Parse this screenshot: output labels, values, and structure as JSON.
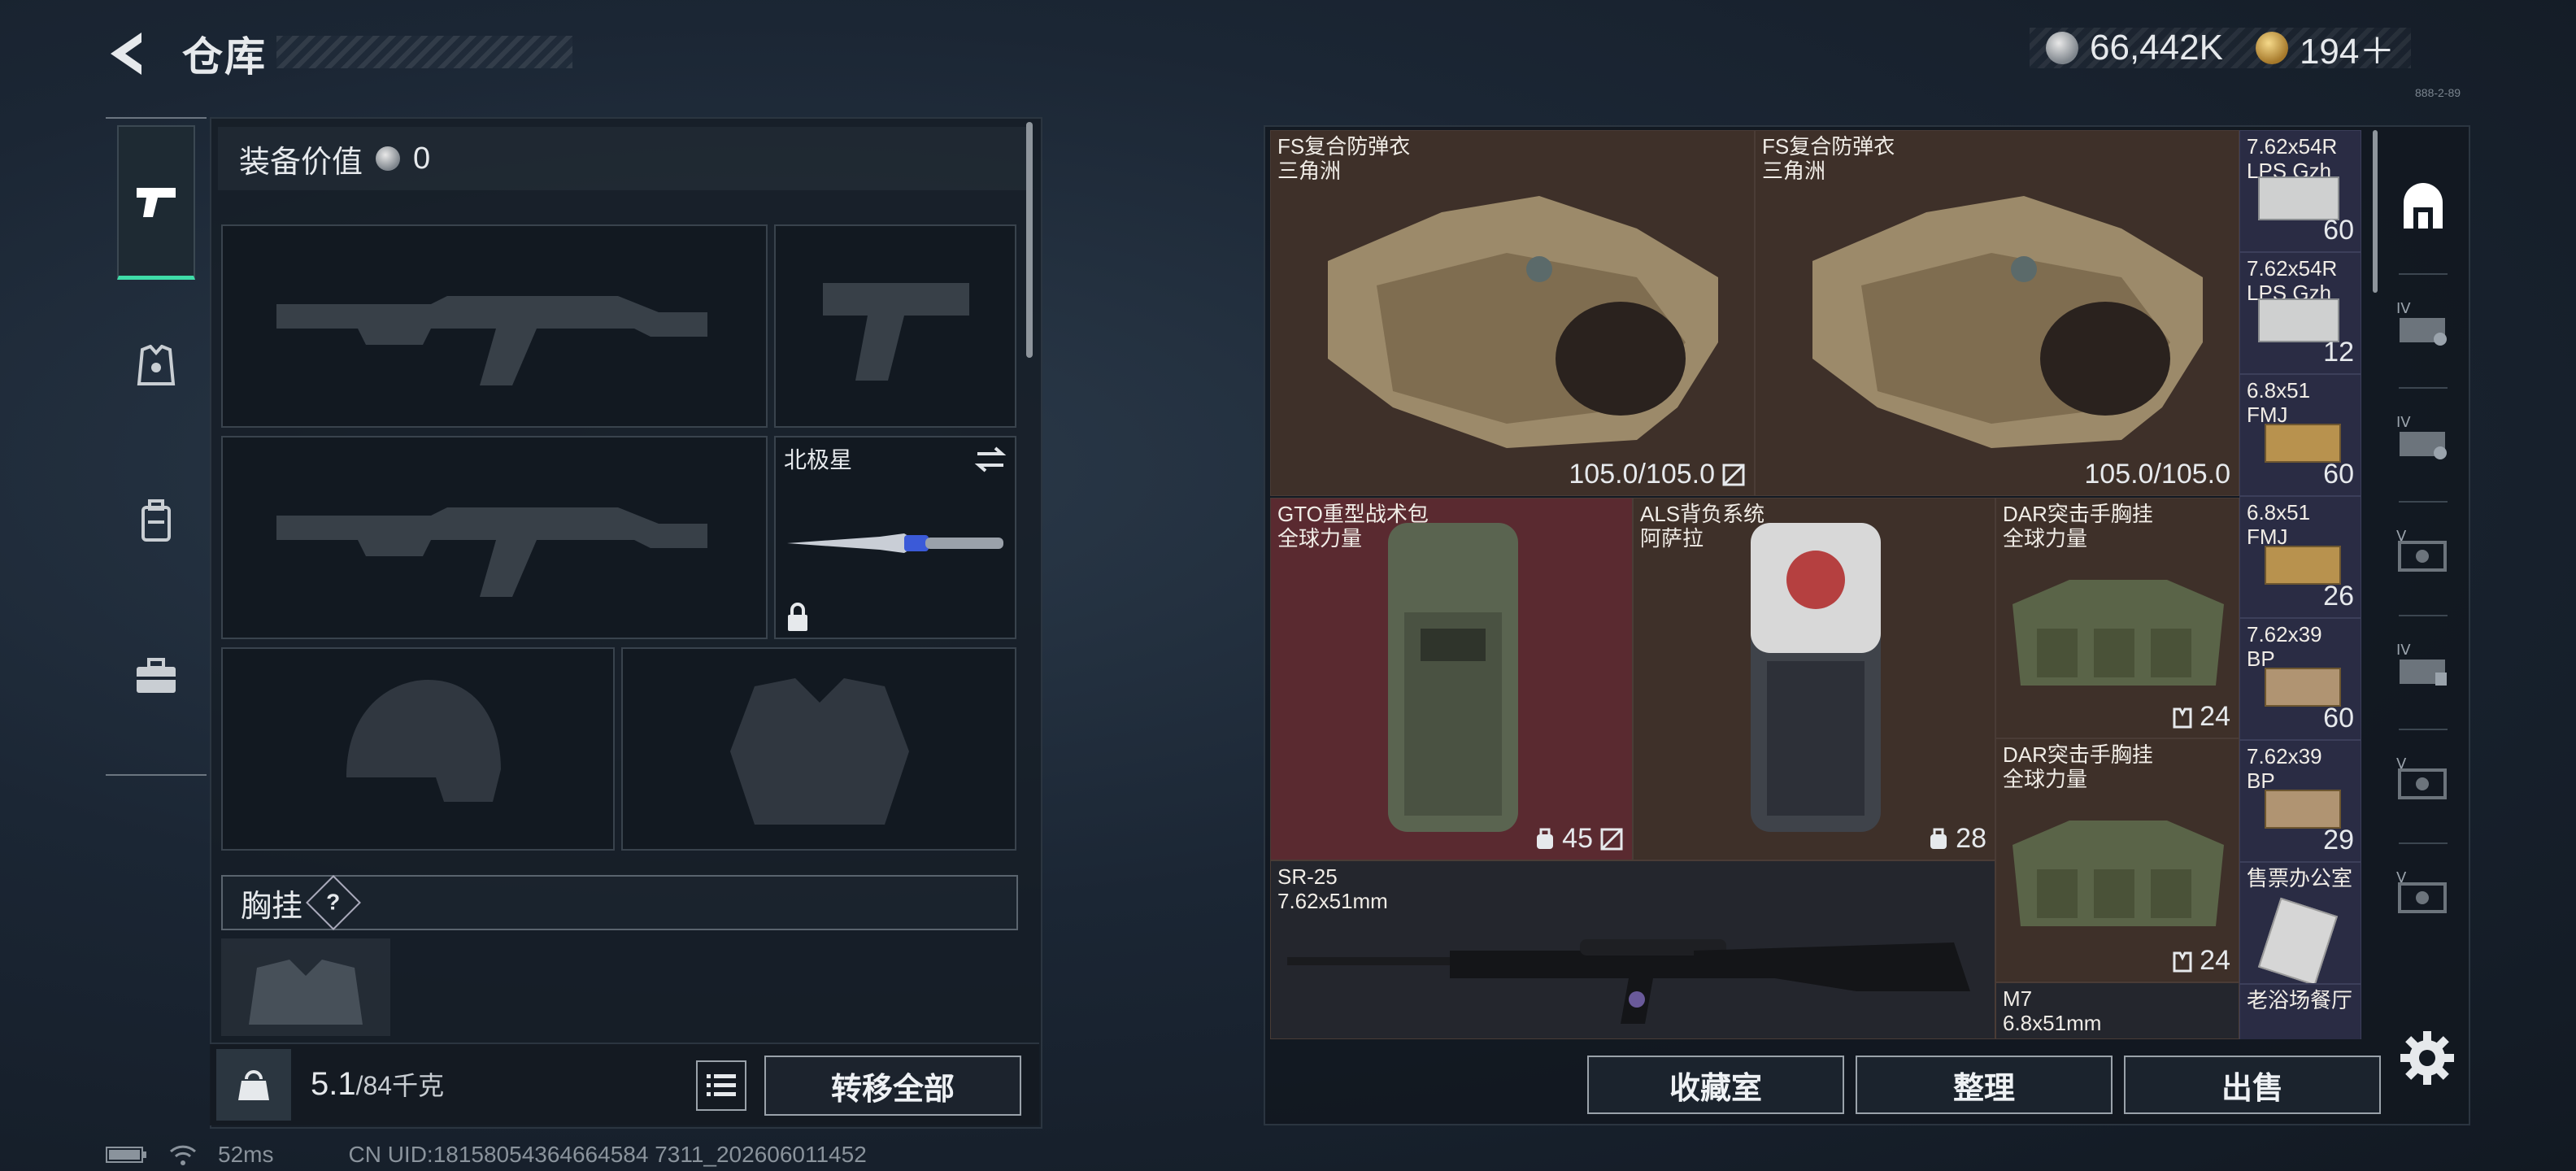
{
  "header": {
    "title": "仓库"
  },
  "currency": {
    "silver": "66,442K",
    "gold": "194＋"
  },
  "build_tag": "888-2-89",
  "tabs": [
    {
      "name": "weapons-tab-icon",
      "active": true
    },
    {
      "name": "armor-tab-icon",
      "active": false
    },
    {
      "name": "backpack-tab-icon",
      "active": false
    },
    {
      "name": "case-tab-icon",
      "active": false
    }
  ],
  "equipment": {
    "value_label": "装备价值",
    "value": "0",
    "melee_name": "北极星",
    "chest_label": "胸挂",
    "help": "?"
  },
  "weight": {
    "current": "5.1",
    "max": "/84千克"
  },
  "buttons": {
    "transfer_all": "转移全部",
    "collection": "收藏室",
    "organize": "整理",
    "sell": "出售"
  },
  "items": {
    "vest1": {
      "name": "FS复合防弹衣\n三角洲",
      "durability": "105.0/105.0"
    },
    "vest2": {
      "name": "FS复合防弹衣\n三角洲",
      "durability": "105.0/105.0"
    },
    "bag1": {
      "name": "GTO重型战术包\n全球力量",
      "capacity": "45"
    },
    "bag2": {
      "name": "ALS背负系统\n阿萨拉",
      "capacity": "28"
    },
    "rig1": {
      "name": "DAR突击手胸挂\n全球力量",
      "capacity": "24"
    },
    "rig2": {
      "name": "DAR突击手胸挂\n全球力量",
      "capacity": "24"
    },
    "rifle": {
      "name": "SR-25\n7.62x51mm"
    },
    "m7": {
      "name": "M7\n6.8x51mm"
    }
  },
  "ammo": [
    {
      "name": "7.62x54R\nLPS Gzh",
      "count": "60"
    },
    {
      "name": "7.62x54R\nLPS Gzh",
      "count": "12"
    },
    {
      "name": "6.8x51\nFMJ",
      "count": "60"
    },
    {
      "name": "6.8x51\nFMJ",
      "count": "26"
    },
    {
      "name": "7.62x39\nBP",
      "count": "60"
    },
    {
      "name": "7.62x39\nBP",
      "count": "29"
    },
    {
      "name": "售票办公室",
      "count": ""
    },
    {
      "name": "老浴场餐厅",
      "count": ""
    }
  ],
  "status": {
    "ping": "52ms",
    "uid": "CN UID:18158054364664584 7311_202606011452"
  },
  "colors": {
    "accent": "#3fdca8",
    "brown_cell": "#3e3029",
    "red_cell": "#5a2a30",
    "ammo_cell": "#2a2c44"
  }
}
